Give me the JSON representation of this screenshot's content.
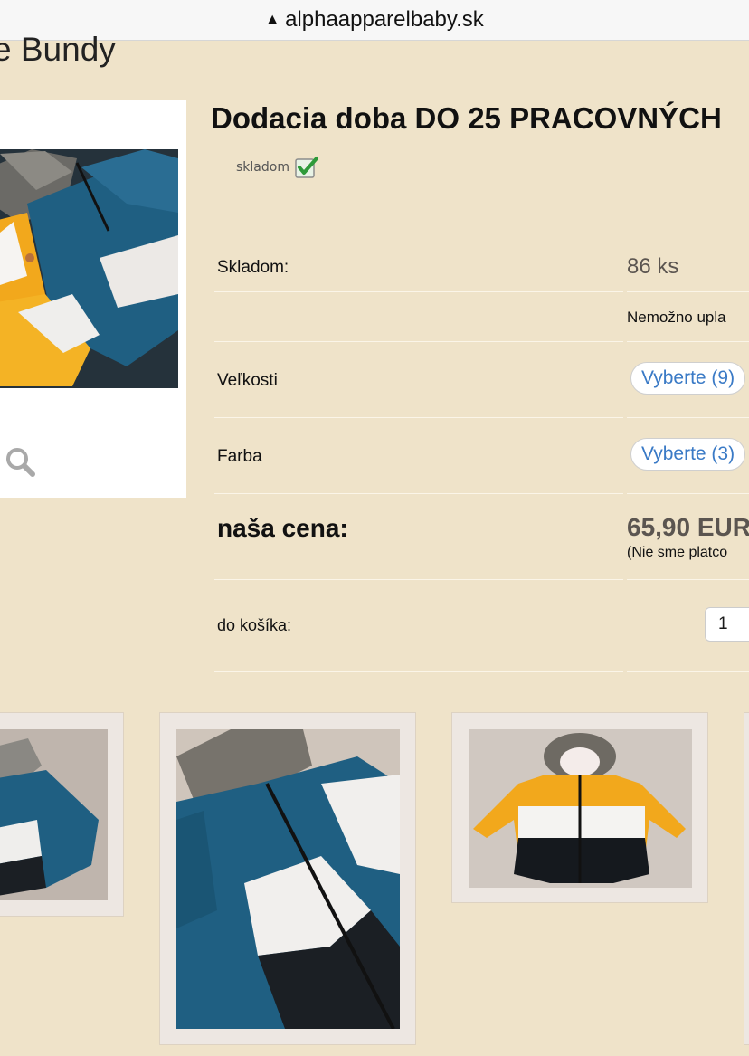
{
  "browser": {
    "url": "alphaapparelbaby.sk"
  },
  "page": {
    "heading": "e Bundy"
  },
  "product": {
    "title": "Dodacia doba DO 25 PRACOVNÝCH",
    "availability": "skladom"
  },
  "details": {
    "stock_label": "Skladom:",
    "stock_value": "86 ks",
    "payment_note": "Nemožno upla",
    "sizes_label": "Veľkosti",
    "sizes_button": "Vyberte (9)",
    "color_label": "Farba",
    "color_button": "Vyberte (3)",
    "price_label": "naša cena:",
    "price_value": "65,90 EUR",
    "price_note": "(Nie sme platco",
    "cart_label": "do košíka:",
    "quantity": "1"
  },
  "colors": {
    "background": "#efe3c9",
    "link_blue": "#3a7ac6",
    "check_green": "#2e9a3a",
    "jacket_blue": "#1f5f82",
    "jacket_yellow": "#f2a81c"
  }
}
